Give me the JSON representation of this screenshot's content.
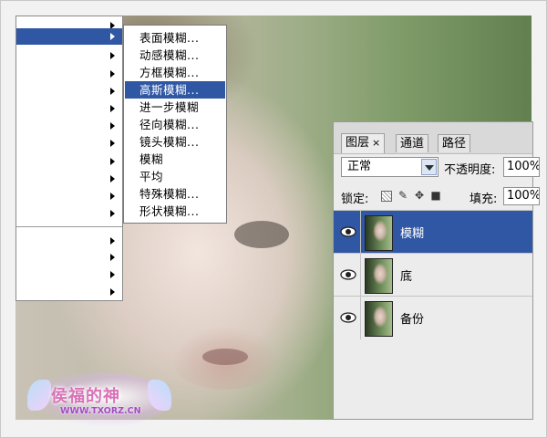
{
  "menu": {
    "filter_submenu": {
      "items": [
        {
          "label": "表面模糊..."
        },
        {
          "label": "动感模糊..."
        },
        {
          "label": "方框模糊..."
        },
        {
          "label": "高斯模糊...",
          "selected": true
        },
        {
          "label": "进一步模糊"
        },
        {
          "label": "径向模糊..."
        },
        {
          "label": "镜头模糊..."
        },
        {
          "label": "模糊"
        },
        {
          "label": "平均"
        },
        {
          "label": "特殊模糊..."
        },
        {
          "label": "形状模糊..."
        }
      ]
    }
  },
  "layers_panel": {
    "tabs": [
      {
        "label": "图层",
        "active": true,
        "close": "×"
      },
      {
        "label": "通道"
      },
      {
        "label": "路径"
      }
    ],
    "blend_mode": "正常",
    "opacity_label": "不透明度:",
    "opacity_value": "100%",
    "lock_label": "锁定:",
    "fill_label": "填充:",
    "fill_value": "100%",
    "layers": [
      {
        "name": "模糊",
        "selected": true,
        "visible": true
      },
      {
        "name": "底",
        "selected": false,
        "visible": true
      },
      {
        "name": "备份",
        "selected": false,
        "visible": true
      }
    ]
  },
  "watermark": {
    "title": "侯福的神",
    "url": "WWW.TXORZ.CN"
  },
  "colors": {
    "selection": "#2f57a4",
    "panel_bg": "#ececec"
  }
}
